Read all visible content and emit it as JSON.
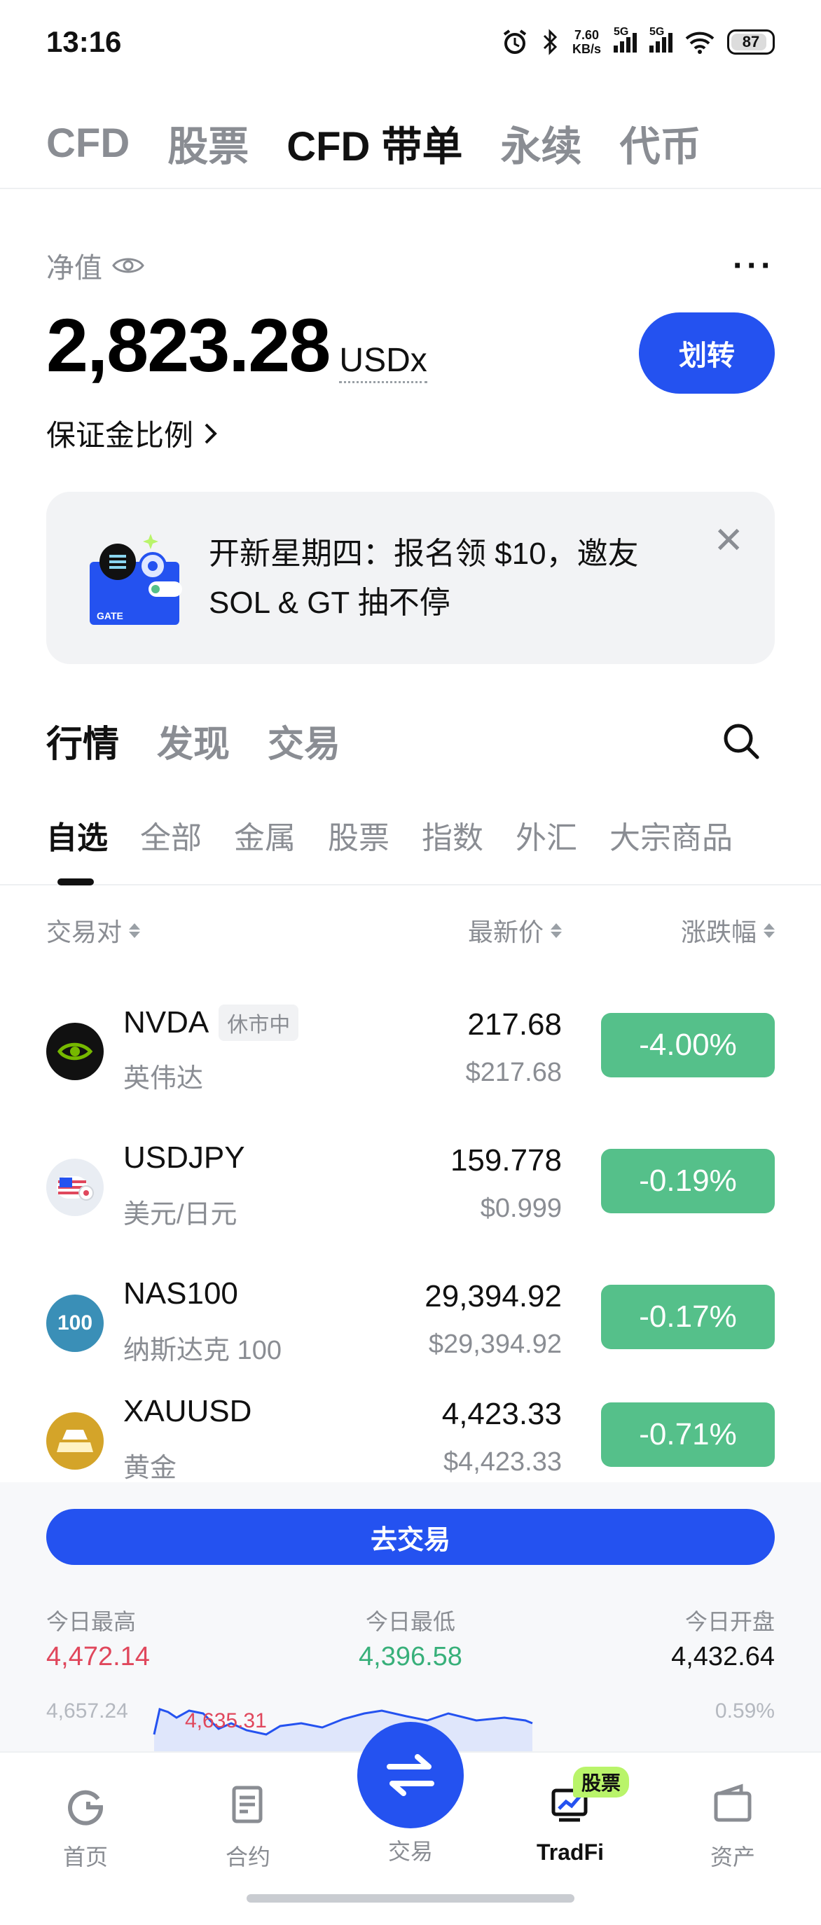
{
  "status_bar": {
    "time": "13:16",
    "net_speed": "7.60",
    "net_unit": "KB/s",
    "sim1": "5G",
    "sim2": "5G",
    "battery": "87"
  },
  "top_tabs": [
    {
      "label": "CFD"
    },
    {
      "label": "股票"
    },
    {
      "label": "CFD 带单"
    },
    {
      "label": "永续"
    },
    {
      "label": "代币"
    }
  ],
  "top_tabs_active": 2,
  "account": {
    "equity_label": "净值",
    "equity_value": "2,823.28",
    "equity_unit": "USDx",
    "transfer_label": "划转",
    "margin_ratio_label": "保证金比例"
  },
  "promo": {
    "text": "开新星期四：报名领 $10，邀友 SOL & GT 抽不停",
    "art_label": "GATE"
  },
  "section_tabs": [
    {
      "label": "行情"
    },
    {
      "label": "发现"
    },
    {
      "label": "交易"
    }
  ],
  "category_tabs": [
    {
      "label": "自选"
    },
    {
      "label": "全部"
    },
    {
      "label": "金属"
    },
    {
      "label": "股票"
    },
    {
      "label": "指数"
    },
    {
      "label": "外汇"
    },
    {
      "label": "大宗商品"
    }
  ],
  "list_header": {
    "pair": "交易对",
    "price": "最新价",
    "change": "涨跌幅"
  },
  "rows": [
    {
      "symbol": "NVDA",
      "badge": "休市中",
      "name": "英伟达",
      "price": "217.68",
      "usd_price": "$217.68",
      "change": "-4.00%",
      "icon": "nvidia-logo-icon",
      "icon_color": "#111111"
    },
    {
      "symbol": "USDJPY",
      "badge": "",
      "name": "美元/日元",
      "price": "159.778",
      "usd_price": "$0.999",
      "change": "-0.19%",
      "icon": "us-jp-flag-icon",
      "icon_color": "#e9edf3"
    },
    {
      "symbol": "NAS100",
      "badge": "",
      "name": "纳斯达克 100",
      "price": "29,394.92",
      "usd_price": "$29,394.92",
      "change": "-0.17%",
      "icon": "nas100-icon",
      "icon_text": "100",
      "icon_color": "#3a8fb7"
    },
    {
      "symbol": "XAUUSD",
      "badge": "",
      "name": "黄金",
      "price": "4,423.33",
      "usd_price": "$4,423.33",
      "change": "-0.71%",
      "icon": "gold-bars-icon",
      "icon_color": "#d4a429"
    }
  ],
  "detail": {
    "go_trade_label": "去交易",
    "high_label": "今日最高",
    "high_value": "4,472.14",
    "low_label": "今日最低",
    "low_value": "4,396.58",
    "open_label": "今日开盘",
    "open_value": "4,432.64",
    "chart_top_left": "4,657.24",
    "chart_peak": "4,635.31",
    "chart_top_right": "0.59%"
  },
  "bottom_nav": [
    {
      "label": "首页",
      "icon": "home-icon"
    },
    {
      "label": "合约",
      "icon": "contract-icon"
    },
    {
      "label": "交易",
      "icon": "swap-icon"
    },
    {
      "label": "TradFi",
      "icon": "tradfi-icon",
      "badge": "股票"
    },
    {
      "label": "资产",
      "icon": "wallet-icon"
    }
  ],
  "colors": {
    "accent": "#2452f0",
    "down_green": "#55c08a",
    "up_red": "#e0475c",
    "muted": "#8a8d93"
  }
}
